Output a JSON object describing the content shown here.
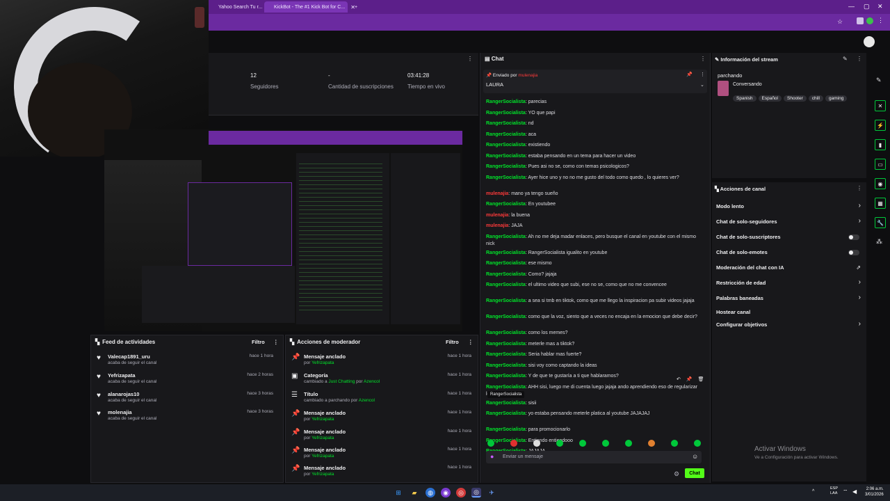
{
  "browser": {
    "tabs": [
      {
        "label": "Yahoo Search Tu r..."
      },
      {
        "label": "KickBot - The #1 Kick Bot for C..."
      }
    ],
    "new_tab": "+"
  },
  "stats": {
    "followers_value": "12",
    "followers_label": "Seguidores",
    "subs_value": "-",
    "subs_label": "Cantidad de suscripciones",
    "live_value": "03:41:28",
    "live_label": "Tiempo en vivo"
  },
  "activity": {
    "title": "Feed de actividades",
    "filter": "Filtro",
    "items": [
      {
        "name": "Valecap1891_uru",
        "sub": "acaba de seguir el canal",
        "time": "hace 1 hora"
      },
      {
        "name": "Yefrizapata",
        "sub": "acaba de seguir el canal",
        "time": "hace 2 horas"
      },
      {
        "name": "alanarojas10",
        "sub": "acaba de seguir el canal",
        "time": "hace 3 horas"
      },
      {
        "name": "molenajia",
        "sub": "acaba de seguir el canal",
        "time": "hace 3 horas"
      }
    ]
  },
  "moderator": {
    "title": "Acciones de moderador",
    "filter": "Filtro",
    "items": [
      {
        "title": "Mensaje anclado",
        "pre": "por ",
        "user": "Yefrizapata",
        "mid": "",
        "user2": "",
        "time": "hace 1 hora"
      },
      {
        "title": "Categoría",
        "pre": "cambiado a ",
        "user": "Just Chatting",
        "mid": " por ",
        "user2": "Azencol",
        "time": "hace 1 hora"
      },
      {
        "title": "Título",
        "pre": "cambiado a ",
        "user": "",
        "mid": "parchando por ",
        "user2": "Azencol",
        "time": "hace 1 hora"
      },
      {
        "title": "Mensaje anclado",
        "pre": "por ",
        "user": "Yefrizapata",
        "mid": "",
        "user2": "",
        "time": "hace 1 hora"
      },
      {
        "title": "Mensaje anclado",
        "pre": "por ",
        "user": "Yefrizapata",
        "mid": "",
        "user2": "",
        "time": "hace 1 hora"
      },
      {
        "title": "Mensaje anclado",
        "pre": "por ",
        "user": "Yefrizapata",
        "mid": "",
        "user2": "",
        "time": "hace 1 hora"
      },
      {
        "title": "Mensaje anclado",
        "pre": "por ",
        "user": "Yefrizapata",
        "mid": "",
        "user2": "",
        "time": "hace 1 hora"
      }
    ]
  },
  "chat": {
    "title": "Chat",
    "pinned_by_label": "Enviado por",
    "pinned_user": "mulenajia",
    "pinned_text": "LAURA",
    "messages": [
      {
        "user": "RangerSocialista",
        "text": "parecias",
        "red": false
      },
      {
        "user": "RangerSocialista",
        "text": "YO que papi",
        "red": false
      },
      {
        "user": "RangerSocialista",
        "text": "nd",
        "red": false
      },
      {
        "user": "RangerSocialista",
        "text": "aca",
        "red": false
      },
      {
        "user": "RangerSocialista",
        "text": "existiendo",
        "red": false
      },
      {
        "user": "RangerSocialista",
        "text": "estaba pensando en un tema para hacer un video",
        "red": false
      },
      {
        "user": "RangerSocialista",
        "text": "Pues asi no se, como con temas psicologicos?",
        "red": false
      },
      {
        "user": "RangerSocialista",
        "text": "Ayer hice uno y no no me gusto del todo como quedo , lo quieres ver?",
        "red": false
      },
      {
        "user": "mulenajia",
        "text": "mano ya tengo sueño",
        "red": true
      },
      {
        "user": "RangerSocialista",
        "text": "En youtubee",
        "red": false
      },
      {
        "user": "mulenajia",
        "text": "la buena",
        "red": true
      },
      {
        "user": "mulenajia",
        "text": "JAJA",
        "red": true
      },
      {
        "user": "RangerSocialista",
        "text": "Ah no me deja madar enlaces, pero busque el canal en youtube con el mismo nick",
        "red": false
      },
      {
        "user": "RangerSocialista",
        "text": "RangerSocialista igualito en youtube",
        "red": false
      },
      {
        "user": "RangerSocialista",
        "text": "ese mismo",
        "red": false
      },
      {
        "user": "RangerSocialista",
        "text": "Como? jajaja",
        "red": false
      },
      {
        "user": "RangerSocialista",
        "text": "el ultimo video que subi, ese no se, como que no me convencee",
        "red": false
      },
      {
        "user": "RangerSocialista",
        "text": "a sea si tmb en tiktok, como que me llego la inspiracion pa subir videos jajaja",
        "red": false
      },
      {
        "user": "RangerSocialista",
        "text": "como que la voz, siento que a veces no encaja en la emocion que debe decir?",
        "red": false
      },
      {
        "user": "RangerSocialista",
        "text": "como los memes?",
        "red": false
      },
      {
        "user": "RangerSocialista",
        "text": "meterle mas a tiktok?",
        "red": false
      },
      {
        "user": "RangerSocialista",
        "text": "Seria hablar mas fuerte?",
        "red": false
      },
      {
        "user": "RangerSocialista",
        "text": "sisi voy como captando la ideas",
        "red": false
      },
      {
        "user": "RangerSocialista",
        "text": "Y de que te gustaría a ti que hablaramos?",
        "red": false
      },
      {
        "user": "RangerSocialista",
        "text": "AHH sisi, luego me di cuenta luego jajaja ando aprendiendo eso de regularizar los volumenes",
        "red": false
      },
      {
        "user": "RangerSocialista",
        "text": "sisii",
        "red": false
      },
      {
        "user": "RangerSocialista",
        "text": "yo estaba pensando meterle platica al youtube JAJAJAJ",
        "red": false
      },
      {
        "user": "RangerSocialista",
        "text": "para promocionarlo",
        "red": false
      },
      {
        "user": "RangerSocialista",
        "text": "Entiendo entiendooo",
        "red": false
      },
      {
        "user": "RangerSocialista",
        "text": "JAJAJA",
        "red": false
      }
    ],
    "tooltip": "RangerSocialista",
    "input_placeholder": "Enviar un mensaje",
    "send_label": "Chat"
  },
  "stream_info": {
    "title": "Información del stream",
    "stream_title": "parchando",
    "category": "Conversando",
    "tags": [
      "Spanish",
      "Español",
      "Shooter",
      "chill",
      "gaming"
    ]
  },
  "channel_actions": {
    "title": "Acciones de canal",
    "items": [
      {
        "label": "Modo lento",
        "control": "chevron"
      },
      {
        "label": "Chat de solo-seguidores",
        "control": "chevron"
      },
      {
        "label": "Chat de solo-suscriptores",
        "control": "toggle"
      },
      {
        "label": "Chat de solo-emotes",
        "control": "toggle"
      },
      {
        "label": "Moderación del chat con IA",
        "control": "external"
      },
      {
        "label": "Restricción de edad",
        "control": "chevron"
      },
      {
        "label": "Palabras baneadas",
        "control": "chevron"
      },
      {
        "label": "Hostear canal",
        "control": "none"
      },
      {
        "label": "Configurar objetivos",
        "control": "chevron"
      }
    ]
  },
  "windows": {
    "activate_title": "Activar Windows",
    "activate_sub": "Ve a Configuración para activar Windows.",
    "lang": "ESP",
    "lang2": "LAA",
    "time": "2:06 a.m.",
    "date": "3/01/2026"
  }
}
